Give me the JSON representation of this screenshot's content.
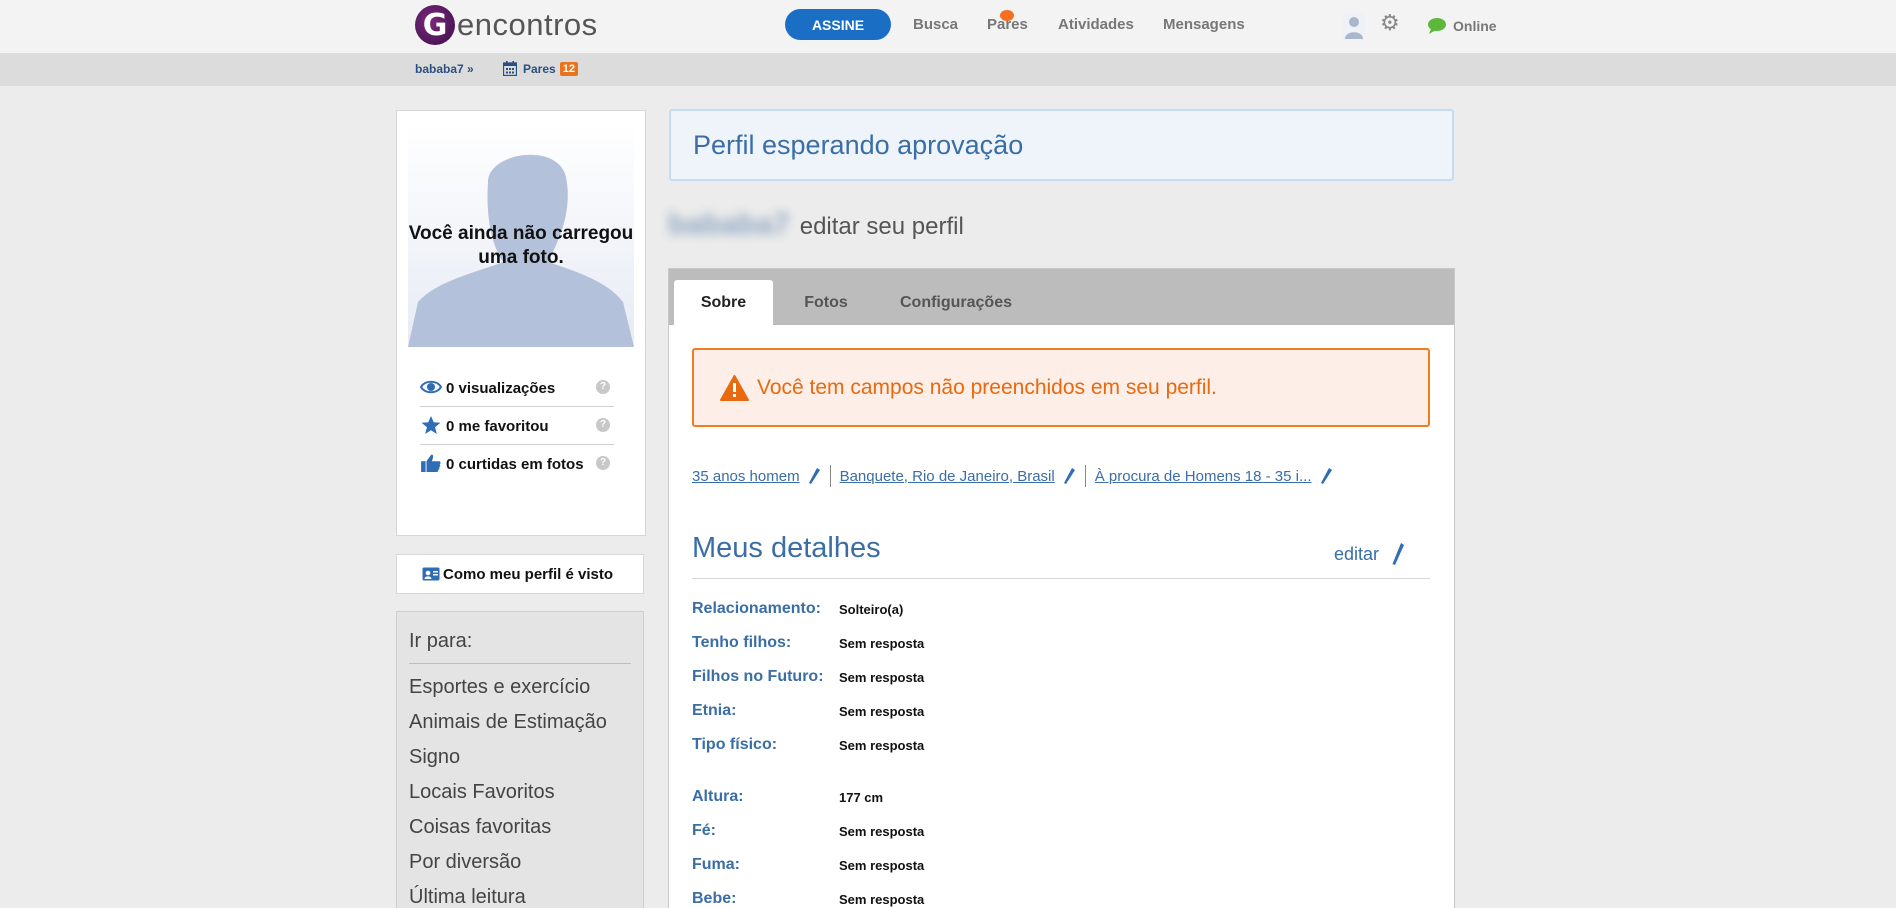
{
  "header": {
    "logo_letter": "G",
    "logo_text": "encontros",
    "subscribe_label": "ASSINE",
    "nav": [
      "Busca",
      "Pares",
      "Atividades",
      "Mensagens"
    ],
    "online_label": "Online"
  },
  "subbar": {
    "user_crumb": "bababa7 »",
    "pares_label": "Pares",
    "pares_count": "12"
  },
  "sidebar": {
    "photo_placeholder": "Você ainda não carregou uma foto.",
    "stats": [
      {
        "label": "0 visualizações",
        "icon": "eye-icon"
      },
      {
        "label": "0 me favoritou",
        "icon": "star-icon"
      },
      {
        "label": "0 curtidas em fotos",
        "icon": "thumbs-up-icon"
      }
    ],
    "help_glyph": "?",
    "profile_view_label": "Como meu perfil é visto",
    "goto_title": "Ir para:",
    "goto_items": [
      "Esportes e exercício",
      "Animais de Estimação",
      "Signo",
      "Locais Favoritos",
      "Coisas favoritas",
      "Por diversão",
      "Última leitura"
    ]
  },
  "main": {
    "approval_banner": "Perfil esperando aprovação",
    "username": "bababa7",
    "edit_profile_title": "editar seu perfil",
    "tabs": [
      "Sobre",
      "Fotos",
      "Configurações"
    ],
    "active_tab": "Sobre",
    "warning": "Você tem campos não preenchidos em seu perfil.",
    "summary_links": [
      "35 anos homem",
      "Banquete, Rio de Janeiro, Brasil",
      "À procura de Homens 18 - 35 i..."
    ],
    "details_title": "Meus detalhes",
    "details_edit": "editar",
    "details": [
      {
        "label": "Relacionamento:",
        "value": "Solteiro(a)"
      },
      {
        "label": "Tenho filhos:",
        "value": "Sem resposta"
      },
      {
        "label": "Filhos no Futuro:",
        "value": "Sem resposta"
      },
      {
        "label": "Etnia:",
        "value": "Sem resposta"
      },
      {
        "label": "Tipo físico:",
        "value": "Sem resposta"
      },
      {
        "label": "Altura:",
        "value": "177 cm"
      },
      {
        "label": "Fé:",
        "value": "Sem resposta"
      },
      {
        "label": "Fuma:",
        "value": "Sem resposta"
      },
      {
        "label": "Bebe:",
        "value": "Sem resposta"
      }
    ]
  },
  "colors": {
    "accent": "#1a6fc4",
    "link": "#3a6ea5",
    "warning": "#f07d1f",
    "badge": "#e9731f"
  }
}
